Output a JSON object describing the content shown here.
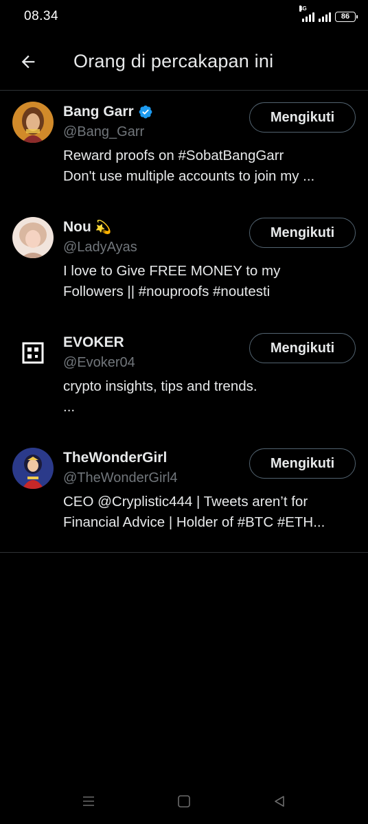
{
  "status_bar": {
    "time": "08.34",
    "network_label": "4G",
    "battery_level": "86"
  },
  "header": {
    "back_icon": "arrow-left-icon",
    "title": "Orang di percakapan ini"
  },
  "users": [
    {
      "display_name": "Bang Garr",
      "handle": "@Bang_Garr",
      "verified": true,
      "emoji": "",
      "bio": "Reward proofs on #SobatBangGarr\nDon't use multiple accounts to join my ...",
      "button_label": "Mengikuti"
    },
    {
      "display_name": "Nou",
      "handle": "@LadyAyas",
      "verified": false,
      "emoji": "💫",
      "bio": "I love to Give FREE MONEY to my\nFollowers ||  #nouproofs #noutesti",
      "button_label": "Mengikuti"
    },
    {
      "display_name": "EVOKER",
      "handle": "@Evoker04",
      "verified": false,
      "emoji": "",
      "bio": "crypto insights, tips and trends.\n...",
      "button_label": "Mengikuti"
    },
    {
      "display_name": "TheWonderGirl",
      "handle": "@TheWonderGirl4",
      "verified": false,
      "emoji": "",
      "bio": "CEO @Cryplistic444 | Tweets aren’t for\nFinancial Advice | Holder of #BTC #ETH...",
      "button_label": "Mengikuti"
    }
  ],
  "nav_bar": {
    "items": [
      "menu-icon",
      "home-square-icon",
      "back-triangle-icon"
    ]
  },
  "colors": {
    "background": "#000000",
    "text_primary": "#e7e9ea",
    "text_secondary": "#71767b",
    "divider": "#2f3336",
    "verified_blue": "#1d9bf0"
  }
}
